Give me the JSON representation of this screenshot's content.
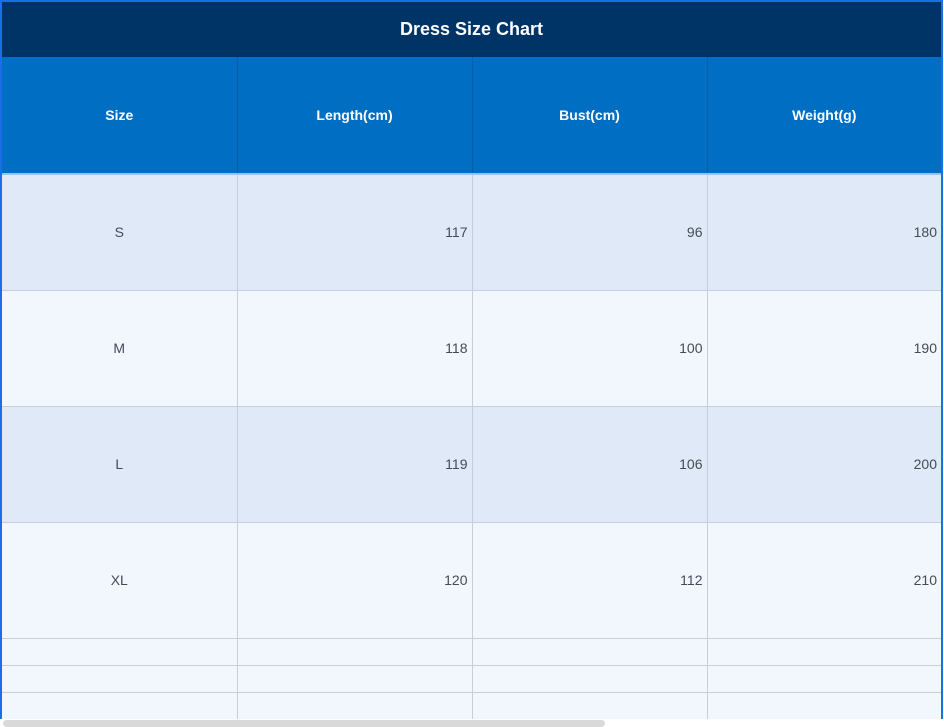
{
  "title": "Dress Size Chart",
  "columns": [
    "Size",
    "Length(cm)",
    "Bust(cm)",
    "Weight(g)"
  ],
  "rows": [
    {
      "size": "S",
      "length": "117",
      "bust": "96",
      "weight": "180"
    },
    {
      "size": "M",
      "length": "118",
      "bust": "100",
      "weight": "190"
    },
    {
      "size": "L",
      "length": "119",
      "bust": "106",
      "weight": "200"
    },
    {
      "size": "XL",
      "length": "120",
      "bust": "112",
      "weight": "210"
    }
  ],
  "colors": {
    "title_bg": "#003366",
    "header_bg": "#006ec3",
    "row_odd": "#e0e9f7",
    "row_even": "#f2f6fd"
  }
}
